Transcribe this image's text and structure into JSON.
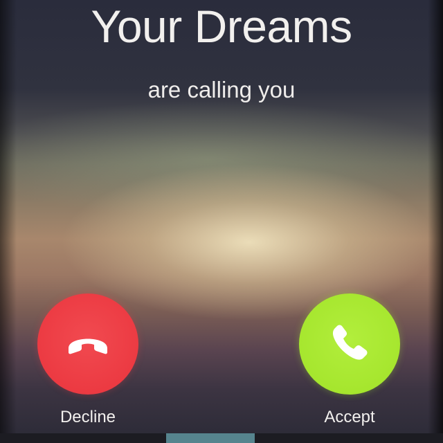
{
  "call_screen": {
    "caller_name": "Your Dreams",
    "status_text": "are calling you"
  },
  "actions": {
    "decline": {
      "label": "Decline",
      "icon": "phone-hangup-icon",
      "color": "#ec3a42"
    },
    "accept": {
      "label": "Accept",
      "icon": "phone-icon",
      "color": "#a6e62e"
    }
  }
}
